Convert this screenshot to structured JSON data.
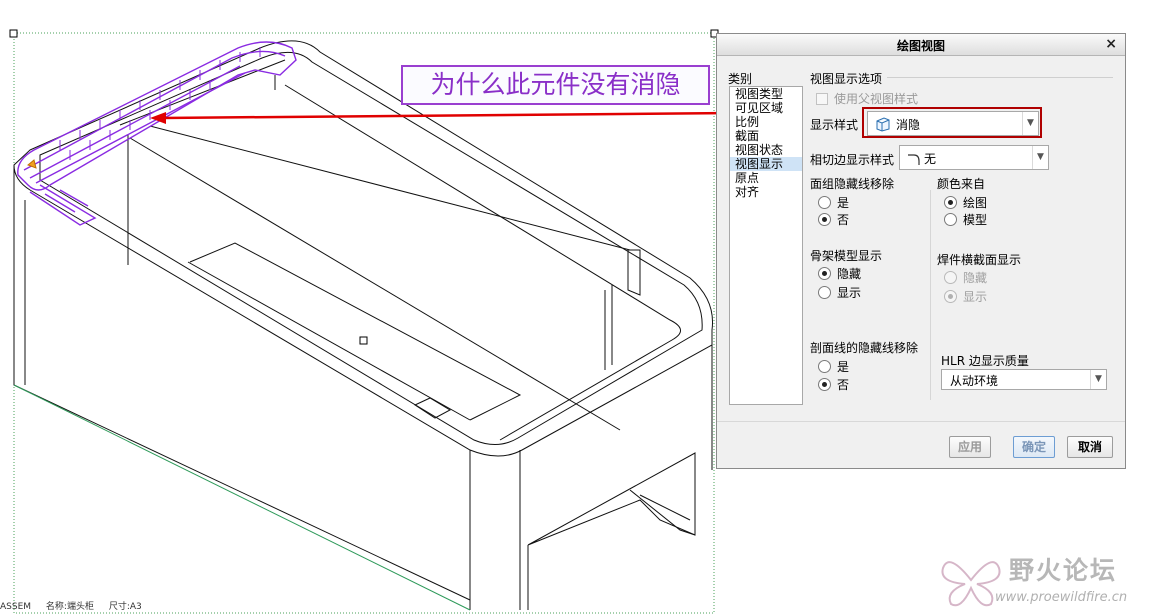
{
  "annotation": {
    "callout_text": "为什么此元件没有消隐"
  },
  "statusbar": {
    "type": "ASSEM",
    "name": "名称:端头柜",
    "size": "尺寸:A3"
  },
  "watermark": {
    "title": "野火论坛",
    "url": "www.proewildfire.cn"
  },
  "dialog": {
    "title": "绘图视图",
    "close_glyph": "×",
    "category_label": "类别",
    "categories": [
      {
        "label": "视图类型",
        "selected": false
      },
      {
        "label": "可见区域",
        "selected": false
      },
      {
        "label": "比例",
        "selected": false
      },
      {
        "label": "截面",
        "selected": false
      },
      {
        "label": "视图状态",
        "selected": false
      },
      {
        "label": "视图显示",
        "selected": true
      },
      {
        "label": "原点",
        "selected": false
      },
      {
        "label": "对齐",
        "selected": false
      }
    ],
    "section_title": "视图显示选项",
    "use_parent_style": {
      "label": "使用父视图样式",
      "checked": false,
      "disabled": true
    },
    "display_style": {
      "label": "显示样式",
      "value": "消隐",
      "icon": "hidden-line-cube-icon"
    },
    "tangent_edge": {
      "label": "相切边显示样式",
      "value": "无",
      "icon": "tangent-edge-icon"
    },
    "quilt_hidden_line_removal": {
      "label": "面组隐藏线移除",
      "options": [
        {
          "label": "是",
          "selected": false
        },
        {
          "label": "否",
          "selected": true
        }
      ]
    },
    "color_from": {
      "label": "颜色来自",
      "options": [
        {
          "label": "绘图",
          "selected": true
        },
        {
          "label": "模型",
          "selected": false
        }
      ]
    },
    "skeleton_display": {
      "label": "骨架模型显示",
      "options": [
        {
          "label": "隐藏",
          "selected": true
        },
        {
          "label": "显示",
          "selected": false
        }
      ]
    },
    "weld_xsec_display": {
      "label": "焊件横截面显示",
      "disabled": true,
      "options": [
        {
          "label": "隐藏",
          "selected": false
        },
        {
          "label": "显示",
          "selected": true
        }
      ]
    },
    "xhatch_hidden_line_removal": {
      "label": "剖面线的隐藏线移除",
      "options": [
        {
          "label": "是",
          "selected": false
        },
        {
          "label": "否",
          "selected": true
        }
      ]
    },
    "hlr_quality": {
      "label": "HLR 边显示质量",
      "value": "从动环境"
    },
    "buttons": {
      "apply": "应用",
      "ok": "确定",
      "cancel": "取消"
    }
  },
  "colors": {
    "model_lines": "#000000",
    "highlight_component": "#8a2be2",
    "arrow": "#e00000",
    "dialog_highlight": "#b00000",
    "drawing_border": "#2e9a5a"
  }
}
